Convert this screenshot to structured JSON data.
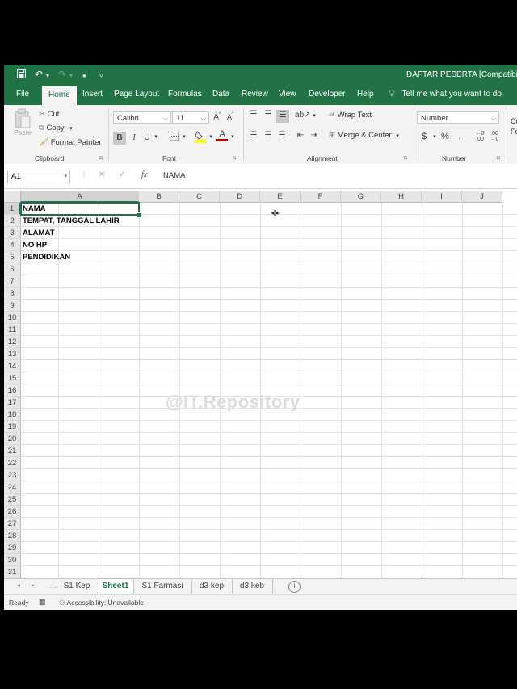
{
  "title_bar": {
    "document_title": "DAFTAR PESERTA  [Compatibility",
    "quick_access": [
      "save-icon",
      "undo-icon",
      "redo-icon",
      "touch-mode-icon",
      "customize-icon"
    ]
  },
  "tabs": [
    "File",
    "Home",
    "Insert",
    "Page Layout",
    "Formulas",
    "Data",
    "Review",
    "View",
    "Developer",
    "Help"
  ],
  "active_tab": "Home",
  "tell_me": "Tell me what you want to do",
  "ribbon": {
    "clipboard": {
      "paste": "Paste",
      "cut": "Cut",
      "copy": "Copy",
      "format_painter": "Format Painter",
      "label": "Clipboard"
    },
    "font": {
      "family": "Calibri",
      "size": "11",
      "bold": "B",
      "italic": "I",
      "underline": "U",
      "label": "Font",
      "font_color": "#c00000",
      "fill_color": "#ffff00"
    },
    "alignment": {
      "wrap_text": "Wrap Text",
      "merge_center": "Merge & Center",
      "label": "Alignment"
    },
    "number": {
      "format": "Number",
      "currency": "$",
      "percent": "%",
      "comma": ",",
      "label": "Number"
    },
    "styles_partial": "Co\nFo"
  },
  "formula_bar": {
    "name_box": "A1",
    "fx": "fx",
    "content": "NAMA"
  },
  "grid": {
    "columns": [
      "A",
      "B",
      "C",
      "D",
      "E",
      "F",
      "G",
      "H",
      "I",
      "J"
    ],
    "rows": [
      "1",
      "2",
      "3",
      "4",
      "5",
      "6",
      "7",
      "8",
      "9",
      "10",
      "11",
      "12",
      "13",
      "14",
      "15",
      "16",
      "17",
      "18",
      "19",
      "20",
      "21",
      "22",
      "23",
      "24",
      "25",
      "26",
      "27",
      "28",
      "29",
      "30",
      "31"
    ],
    "cells_col_a": [
      "NAMA",
      "TEMPAT, TANGGAL LAHIR",
      "ALAMAT",
      "NO HP",
      "PENDIDIKAN"
    ],
    "selected_cell": "A1"
  },
  "watermark": "@IT.Repository",
  "sheet_tabs": [
    "S1 Kep",
    "Sheet1",
    "S1 Farmasi",
    "d3 kep",
    "d3 keb"
  ],
  "active_sheet": "Sheet1",
  "status_bar": {
    "ready": "Ready",
    "accessibility": "Accessibility: Unavailable"
  },
  "colors": {
    "accent": "#217346",
    "ribbon_bg": "#f3f3f3",
    "background": "#000000"
  }
}
